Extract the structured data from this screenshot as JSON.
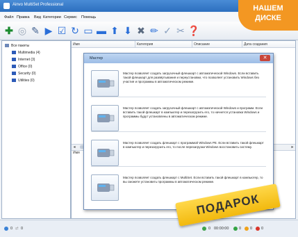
{
  "window": {
    "title": "Ainvo MultiSet Professional"
  },
  "menu": [
    "Файл",
    "Правка",
    "Вид",
    "Категории",
    "Сервис",
    "Помощь"
  ],
  "toolbar_icons": [
    "add-icon",
    "globe-icon",
    "wrench-icon",
    "play-icon",
    "checkbox-icon",
    "refresh-icon",
    "monitor-icon",
    "screen-icon",
    "arrow-up-icon",
    "arrow-down-icon",
    "delete-icon",
    "pencil-icon",
    "check-icon",
    "tools-icon",
    "help-icon"
  ],
  "sidebar": {
    "root": "Все пакеты",
    "items": [
      "Multimedia (4)",
      "Internet (3)",
      "Office (0)",
      "Security (0)",
      "Utilities (0)"
    ]
  },
  "list": {
    "columns": [
      "Имя",
      "Категория",
      "Описание",
      "Дата создания"
    ],
    "lower_column": "Имя"
  },
  "dialog": {
    "title": "Мастер",
    "options": [
      {
        "text": "Мастер позволяет создать загрузочный флешкарт с автоматической Windows. Если вставить такой флешкарт для развёртывания и переустановки, что позволяет установить Windows без участия и программы в автоматическом режиме."
      },
      {
        "text": "Мастер позволяет создать загрузочный флешкарт с автоматической Windows и программ. Если вставить такой флешкарт в компьютер и перезагрузить его, то начнется установка Windows и программы будут установлены в автоматическом режиме."
      },
      {
        "text": "Мастер позволяет создать флешкарт с программой Windows PE. Если вставить такой флешкарт в компьютер и перезагрузить его, то после перезагрузки Windows восстановить систему."
      },
      {
        "text": "Мастер позволяет создать флешкарт с MultiSet. Если вставить такой флешкарт в компьютер, то вы сможете установить программы в автоматическом режиме."
      }
    ]
  },
  "status": {
    "left_a": "0",
    "left_b": "0",
    "time": "00:00:00",
    "c1": "0",
    "c2": "0",
    "c3": "0"
  },
  "badge": {
    "line1": "НАШЕМ",
    "line2": "ДИСКЕ"
  },
  "ribbon": {
    "text": "ПОДАРОК"
  },
  "colors": {
    "accent": "#2c6fbf",
    "badge": "#f39722",
    "ribbon": "#f2b90e"
  }
}
